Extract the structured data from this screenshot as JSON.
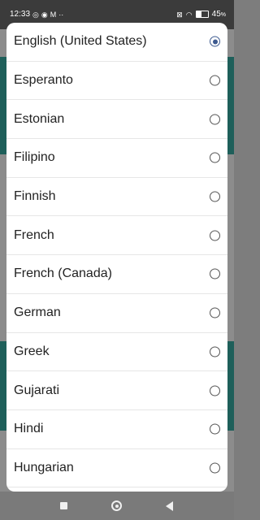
{
  "status_bar": {
    "time": "12:33",
    "battery": "45",
    "battery_unit": "%",
    "icons_left": [
      "whatsapp-icon",
      "messenger-icon",
      "gmail-icon",
      "more-dots-icon"
    ],
    "icons_right": [
      "sim-off-icon",
      "wifi-icon",
      "battery-icon"
    ]
  },
  "dialog": {
    "options": [
      {
        "label": "English (United States)",
        "selected": true
      },
      {
        "label": "Esperanto",
        "selected": false
      },
      {
        "label": "Estonian",
        "selected": false
      },
      {
        "label": "Filipino",
        "selected": false
      },
      {
        "label": "Finnish",
        "selected": false
      },
      {
        "label": "French",
        "selected": false
      },
      {
        "label": "French (Canada)",
        "selected": false
      },
      {
        "label": "German",
        "selected": false
      },
      {
        "label": "Greek",
        "selected": false
      },
      {
        "label": "Gujarati",
        "selected": false
      },
      {
        "label": "Hindi",
        "selected": false
      },
      {
        "label": "Hungarian",
        "selected": false
      }
    ]
  },
  "colors": {
    "radio_selected": "#3d5a8f",
    "background_app_band": "#1e5f5a"
  },
  "nav_bar": {
    "buttons": [
      "recents-button",
      "home-button",
      "back-button"
    ]
  }
}
